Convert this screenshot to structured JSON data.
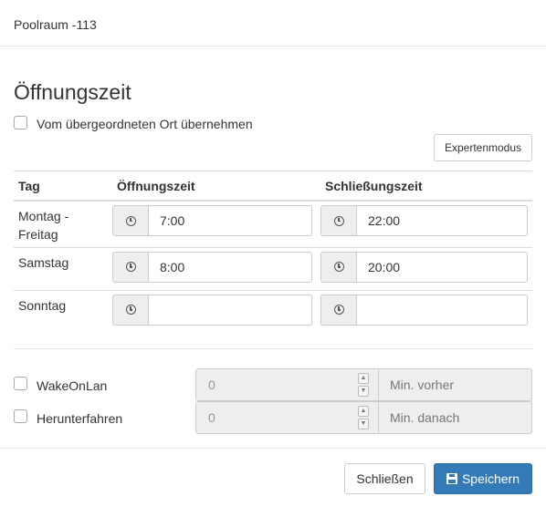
{
  "modal": {
    "title": "Poolraum -113"
  },
  "section": {
    "title": "Öffnungszeit"
  },
  "inherit_checkbox": {
    "label": "Vom übergeordneten Ort übernehmen",
    "checked": false
  },
  "expert_button": {
    "label": "Expertenmodus"
  },
  "table": {
    "headers": {
      "day": "Tag",
      "open": "Öffnungszeit",
      "close": "Schließungszeit"
    },
    "rows": [
      {
        "day": "Montag - Freitag",
        "open": "7:00",
        "close": "22:00"
      },
      {
        "day": "Samstag",
        "open": "8:00",
        "close": "20:00"
      },
      {
        "day": "Sonntag",
        "open": "",
        "close": ""
      }
    ]
  },
  "wakeonlan": {
    "label": "WakeOnLan",
    "checked": false,
    "value": "0",
    "unit": "Min. vorher"
  },
  "shutdown": {
    "label": "Herunterfahren",
    "checked": false,
    "value": "0",
    "unit": "Min. danach"
  },
  "footer": {
    "close_label": "Schließen",
    "save_label": "Speichern"
  },
  "icons": {
    "time": "clock-icon",
    "save": "floppy-disk-icon"
  },
  "colors": {
    "primary": "#337ab7",
    "addon_bg": "#eeeeee",
    "border": "#cccccc"
  }
}
